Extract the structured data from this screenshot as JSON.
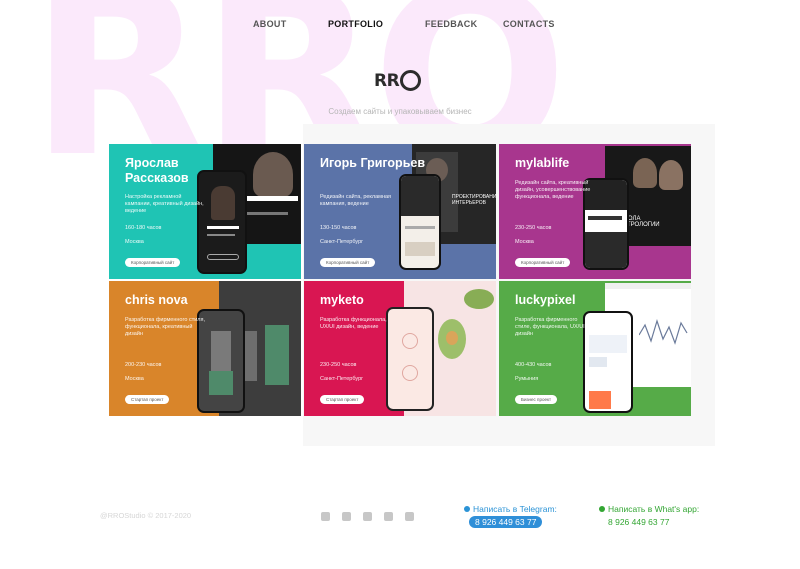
{
  "nav": {
    "items": [
      {
        "label": "ABOUT",
        "active": false
      },
      {
        "label": "PORTFOLIO",
        "active": true
      },
      {
        "label": "FEEDBACK",
        "active": false
      },
      {
        "label": "CONTACTS",
        "active": false
      }
    ]
  },
  "background_text": "RRO",
  "logo": {
    "text": "RR"
  },
  "tagline": "Создаем сайты и упаковываем бизнес",
  "portfolio": [
    {
      "title": "Ярослав Рассказов",
      "desc": "Настройка рекламной кампании, креативный дизайн, ведение",
      "hours": "160-180 часов",
      "city": "Москва",
      "button": "Корпоративный сайт",
      "color": "#1fc4b4"
    },
    {
      "title": "Игорь Григорьев",
      "desc": "Редизайн сайта, рекламная кампания, ведение",
      "hours": "130-150 часов",
      "city": "Санкт-Петербург",
      "button": "Корпоративный сайт",
      "color": "#5b73a8"
    },
    {
      "title": "mylablife",
      "desc": "Редизайн сайта, креативный дизайн, усовершенствование функционала, ведение",
      "hours": "230-250 часов",
      "city": "Москва",
      "button": "Корпоративный сайт",
      "color": "#a8368e"
    },
    {
      "title": "chris nova",
      "desc": "Разработка фирменного стиля, функционала, креативный дизайн",
      "hours": "200-230 часов",
      "city": "Москва",
      "button": "Стартап проект",
      "color": "#d9852a"
    },
    {
      "title": "myketo",
      "desc": "Разработка функционала, UX/UI дизайн, ведение",
      "hours": "230-250 часов",
      "city": "Санкт-Петербург",
      "button": "Стартап проект",
      "color": "#d91652"
    },
    {
      "title": "luckypixel",
      "desc": "Разработка фирменного стиле, функционала, UX/UI дизайн",
      "hours": "400-430 часов",
      "city": "Румыния",
      "button": "Бизнес проект",
      "color": "#56ab48"
    }
  ],
  "mock_texts": {
    "igor_overlay": "ПРОЕКТИРОВАНИЕ ИНТЕРЬЕРОВ",
    "mylab_banner": "ШКОЛА АСТРОЛОГИИ"
  },
  "footer": {
    "copyright": "@RROStudio © 2017-2020",
    "socials": [
      "telegram-icon",
      "behance-icon",
      "vk-icon",
      "instagram-icon",
      "whatsapp-icon"
    ],
    "telegram_label": "Написать в Telegram:",
    "telegram_phone": "8 926 449 63 77",
    "whatsapp_label": "Написать в What's app:",
    "whatsapp_phone": "8 926 449 63 77"
  }
}
